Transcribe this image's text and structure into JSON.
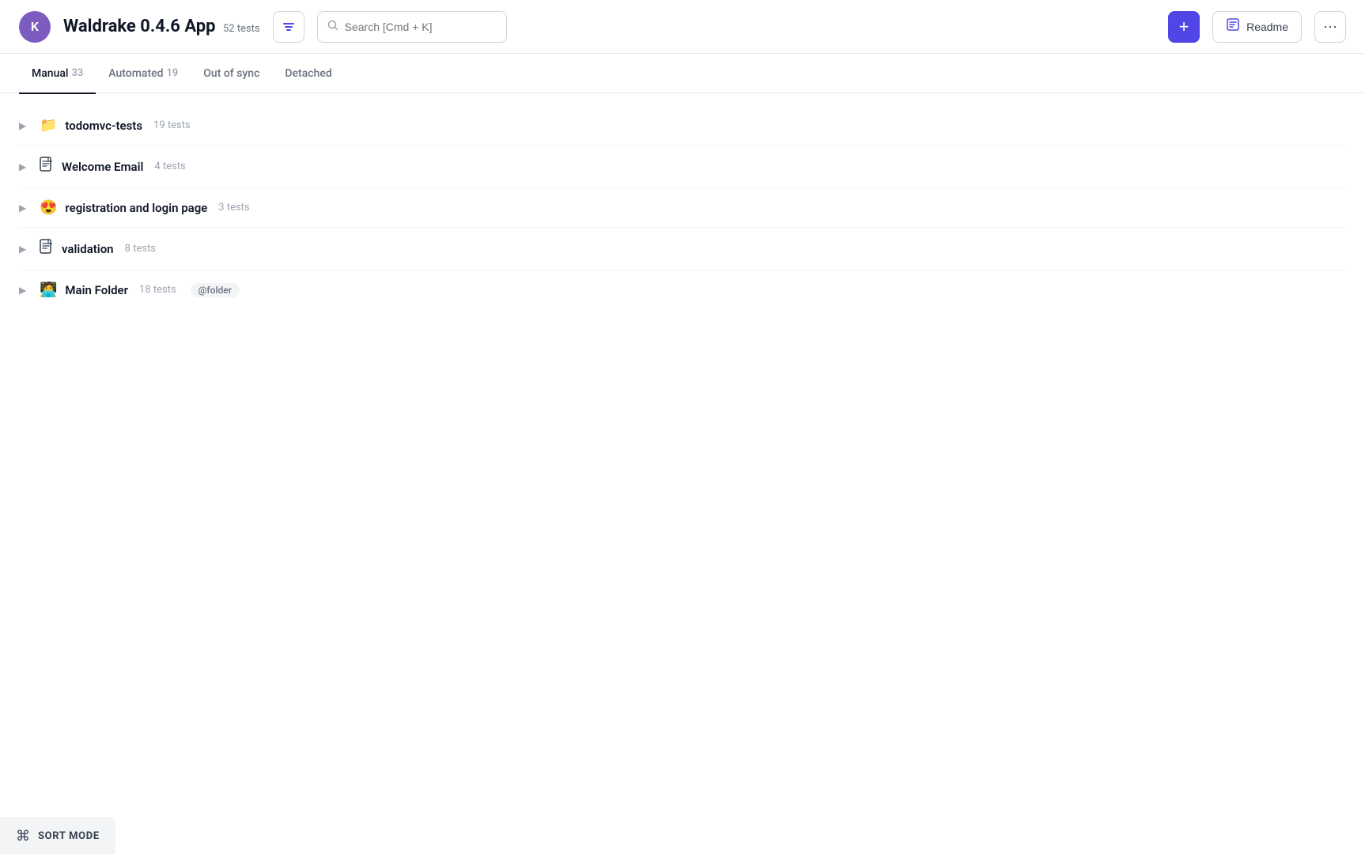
{
  "header": {
    "avatar_initial": "K",
    "app_title": "Waldrake 0.4.6 App",
    "test_count": "52 tests",
    "search_placeholder": "Search [Cmd + K]",
    "add_button_label": "+",
    "readme_button_label": "Readme",
    "more_button_label": "···"
  },
  "tabs": [
    {
      "id": "manual",
      "label": "Manual",
      "count": "33",
      "active": true
    },
    {
      "id": "automated",
      "label": "Automated",
      "count": "19",
      "active": false
    },
    {
      "id": "out-of-sync",
      "label": "Out of sync",
      "count": "",
      "active": false
    },
    {
      "id": "detached",
      "label": "Detached",
      "count": "",
      "active": false
    }
  ],
  "folders": [
    {
      "name": "todomvc-tests",
      "count": "19 tests",
      "icon": "📁",
      "icon_type": "folder",
      "tag": ""
    },
    {
      "name": "Welcome Email",
      "count": "4 tests",
      "icon": "📄",
      "icon_type": "doc",
      "tag": ""
    },
    {
      "name": "registration and login page",
      "count": "3 tests",
      "icon": "😍",
      "icon_type": "emoji",
      "tag": ""
    },
    {
      "name": "validation",
      "count": "8 tests",
      "icon": "📄",
      "icon_type": "doc",
      "tag": ""
    },
    {
      "name": "Main Folder",
      "count": "18 tests",
      "icon": "🧑‍💻",
      "icon_type": "emoji",
      "tag": "@folder"
    }
  ],
  "bottom_bar": {
    "sort_icon": "⌘",
    "sort_label": "SORT MODE"
  },
  "colors": {
    "accent": "#4f46e5",
    "avatar_bg": "#7c5cbf"
  }
}
